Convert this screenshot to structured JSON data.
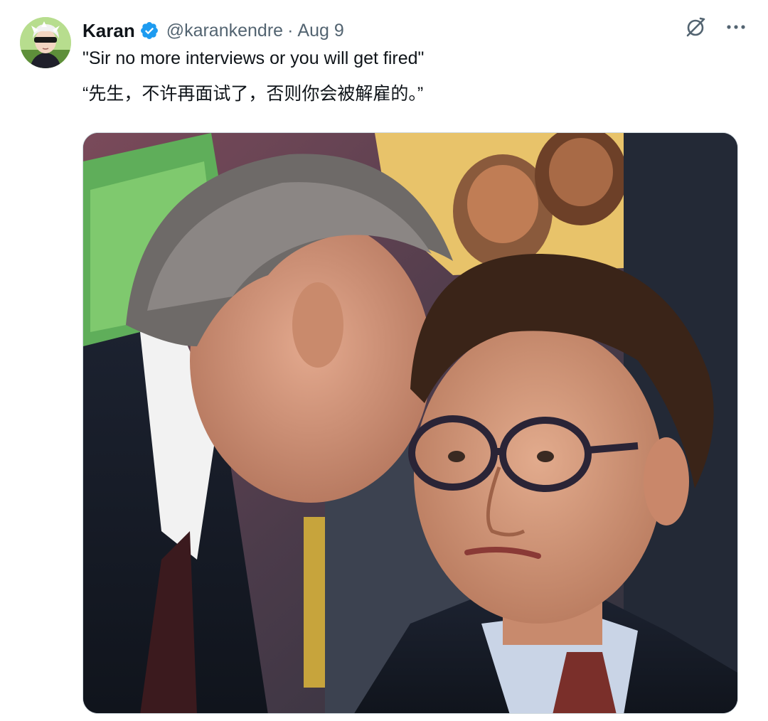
{
  "tweet": {
    "author": {
      "display_name": "Karan",
      "handle": "@karankendre",
      "verified": true,
      "avatar_icon": "user-avatar"
    },
    "separator": "·",
    "date": "Aug 9",
    "text_en": "\"Sir no more interviews or you will get fired\"",
    "text_zh": "“先生，不许再面试了，否则你会被解雇的。”",
    "actions": {
      "grok_icon": "grok-icon",
      "more_icon": "more-icon"
    },
    "media": {
      "type": "photo",
      "description_icon": "photo"
    }
  },
  "colors": {
    "text_primary": "#0f1419",
    "text_secondary": "#536471",
    "verified_blue": "#1d9bf0",
    "border": "#cfd9de"
  }
}
